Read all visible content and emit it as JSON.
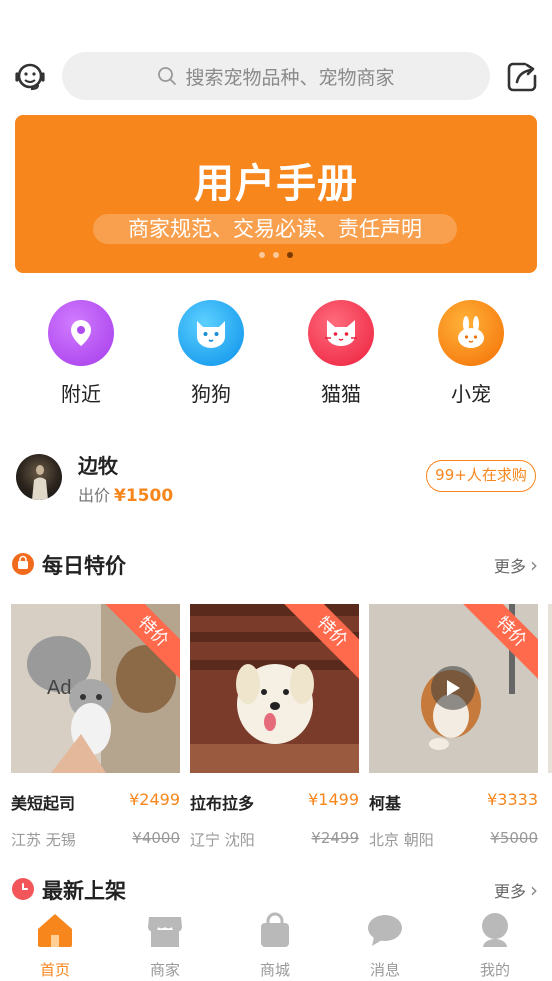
{
  "search": {
    "placeholder": "搜索宠物品种、宠物商家"
  },
  "banner": {
    "title": "用户手册",
    "subtitle": "商家规范、交易必读、责任声明",
    "slides": 3,
    "active_slide": 3
  },
  "categories": [
    {
      "label": "附近",
      "icon": "location-pin-icon",
      "color": "#b04bf0"
    },
    {
      "label": "狗狗",
      "icon": "dog-icon",
      "color": "#1aa5f5"
    },
    {
      "label": "猫猫",
      "icon": "cat-icon",
      "color": "#f5364d"
    },
    {
      "label": "小宠",
      "icon": "rabbit-icon",
      "color": "#f78b0c"
    }
  ],
  "buyer": {
    "name": "边牧",
    "price_label": "出价",
    "price": "¥1500",
    "badge": "99+人在求购"
  },
  "daily_deals": {
    "title": "每日特价",
    "more": "更多",
    "ribbon": "特价",
    "items": [
      {
        "name": "美短起司",
        "price": "¥2499",
        "location": "江苏 无锡",
        "original": "¥4000"
      },
      {
        "name": "拉布拉多",
        "price": "¥1499",
        "location": "辽宁 沈阳",
        "original": "¥2499"
      },
      {
        "name": "柯基",
        "price": "¥3333",
        "location": "北京 朝阳",
        "original": "¥5000"
      }
    ]
  },
  "new_arrivals": {
    "title": "最新上架",
    "more": "更多"
  },
  "tabbar": {
    "active": "首页",
    "items": [
      {
        "label": "首页",
        "icon": "home-icon"
      },
      {
        "label": "商家",
        "icon": "shop-icon"
      },
      {
        "label": "商城",
        "icon": "shopping-bag-icon"
      },
      {
        "label": "消息",
        "icon": "message-icon"
      },
      {
        "label": "我的",
        "icon": "profile-icon"
      }
    ]
  },
  "colors": {
    "accent": "#f7861d",
    "ribbon": "#ff6a4d",
    "deal_icon": "#f26b1d",
    "new_icon": "#f2555a"
  }
}
